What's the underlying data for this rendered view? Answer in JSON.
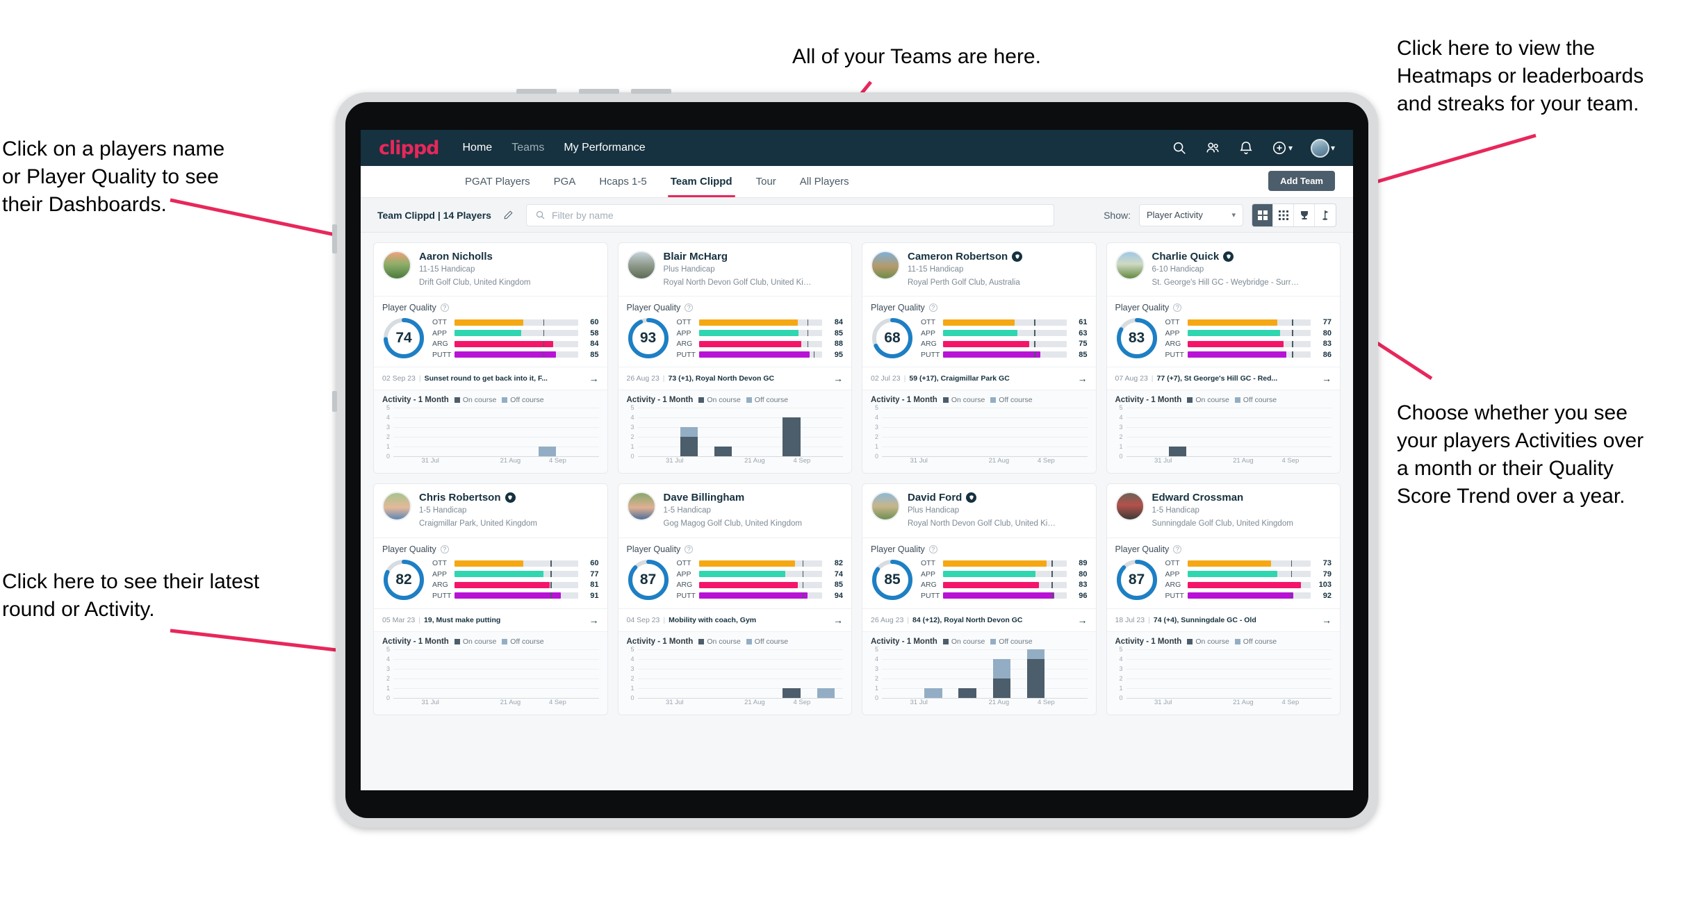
{
  "annotations": [
    {
      "id": "anno-teams",
      "text": "All of your Teams are here."
    },
    {
      "id": "anno-heatmaps",
      "text": "Click here to view the\nHeatmaps or leaderboards\nand streaks for your team."
    },
    {
      "id": "anno-names",
      "text": "Click on a players name\nor Player Quality to see\ntheir Dashboards."
    },
    {
      "id": "anno-activity",
      "text": "Choose whether you see\nyour players Activities over\na month or their Quality\nScore Trend over a year."
    },
    {
      "id": "anno-latest",
      "text": "Click here to see their latest\nround or Activity."
    }
  ],
  "header": {
    "logo": "clippd",
    "nav": [
      {
        "label": "Home",
        "active": true
      },
      {
        "label": "Teams",
        "active": false
      },
      {
        "label": "My Performance",
        "active": true
      }
    ],
    "icons": [
      "search-icon",
      "people-icon",
      "bell-icon",
      "plus-circle-icon"
    ],
    "avatar": "user-avatar"
  },
  "tabs": [
    {
      "label": "PGAT Players",
      "active": false
    },
    {
      "label": "PGA",
      "active": false
    },
    {
      "label": "Hcaps 1-5",
      "active": false
    },
    {
      "label": "Team Clippd",
      "active": true
    },
    {
      "label": "Tour",
      "active": false
    },
    {
      "label": "All Players",
      "active": false
    }
  ],
  "add_team_label": "Add Team",
  "filter_bar": {
    "team_label": "Team Clippd | 14 Players",
    "edit_icon": "pencil-icon",
    "search_placeholder": "Filter by name",
    "search_value": "",
    "show_label": "Show:",
    "show_value": "Player Activity",
    "view_modes": [
      {
        "icon": "grid-large-icon",
        "active": true
      },
      {
        "icon": "grid-dense-icon",
        "active": false
      },
      {
        "icon": "trophy-icon",
        "active": false
      },
      {
        "icon": "flag-pin-icon",
        "active": false
      }
    ]
  },
  "card_labels": {
    "player_quality": "Player Quality",
    "activity_title": "Activity - 1 Month",
    "legend_on": "On course",
    "legend_off": "Off course",
    "y_ticks": [
      "5",
      "4",
      "3",
      "2",
      "1",
      "0"
    ],
    "x_ticks": [
      "31 Jul",
      "21 Aug",
      "4 Sep"
    ]
  },
  "colors": {
    "ott": "#f5a814",
    "app": "#2fd6b0",
    "arg": "#f4156b",
    "putt": "#b712d6",
    "donut": "#1d7fc4",
    "donut_track": "#d7dce1",
    "on_course": "#4c5d6b",
    "off_course": "#93aec4",
    "accent_pink": "#e8275a",
    "header_bg": "#16313f"
  },
  "players": [
    {
      "name": "Aaron Nicholls",
      "verified": false,
      "handicap": "11-15 Handicap",
      "club": "Drift Golf Club, United Kingdom",
      "quality": 74,
      "metrics": [
        {
          "key": "OTT",
          "value": 60,
          "fill": 56,
          "tick": 72
        },
        {
          "key": "APP",
          "value": 58,
          "fill": 54,
          "tick": 72
        },
        {
          "key": "ARG",
          "value": 84,
          "fill": 80,
          "tick": 72
        },
        {
          "key": "PUTT",
          "value": 85,
          "fill": 82,
          "tick": 72
        }
      ],
      "round_date": "02 Sep 23",
      "round_text": "Sunset round to get back into it, F...",
      "activity": [
        {
          "on": 0,
          "off": 0
        },
        {
          "on": 0,
          "off": 0
        },
        {
          "on": 0,
          "off": 0
        },
        {
          "on": 0,
          "off": 0
        },
        {
          "on": 0,
          "off": 1
        },
        {
          "on": 0,
          "off": 0
        }
      ]
    },
    {
      "name": "Blair McHarg",
      "verified": false,
      "handicap": "Plus Handicap",
      "club": "Royal North Devon Golf Club, United Kin...",
      "quality": 93,
      "metrics": [
        {
          "key": "OTT",
          "value": 84,
          "fill": 80,
          "tick": 88
        },
        {
          "key": "APP",
          "value": 85,
          "fill": 81,
          "tick": 88
        },
        {
          "key": "ARG",
          "value": 88,
          "fill": 83,
          "tick": 88
        },
        {
          "key": "PUTT",
          "value": 95,
          "fill": 90,
          "tick": 93
        }
      ],
      "round_date": "26 Aug 23",
      "round_text": "73 (+1), Royal North Devon GC",
      "activity": [
        {
          "on": 0,
          "off": 0
        },
        {
          "on": 2,
          "off": 1
        },
        {
          "on": 1,
          "off": 0
        },
        {
          "on": 0,
          "off": 0
        },
        {
          "on": 4,
          "off": 0
        },
        {
          "on": 0,
          "off": 0
        }
      ]
    },
    {
      "name": "Cameron Robertson",
      "verified": true,
      "handicap": "11-15 Handicap",
      "club": "Royal Perth Golf Club, Australia",
      "quality": 68,
      "metrics": [
        {
          "key": "OTT",
          "value": 61,
          "fill": 58,
          "tick": 74
        },
        {
          "key": "APP",
          "value": 63,
          "fill": 60,
          "tick": 74
        },
        {
          "key": "ARG",
          "value": 75,
          "fill": 70,
          "tick": 74
        },
        {
          "key": "PUTT",
          "value": 85,
          "fill": 79,
          "tick": 74
        }
      ],
      "round_date": "02 Jul 23",
      "round_text": "59 (+17), Craigmillar Park GC",
      "activity": [
        {
          "on": 0,
          "off": 0
        },
        {
          "on": 0,
          "off": 0
        },
        {
          "on": 0,
          "off": 0
        },
        {
          "on": 0,
          "off": 0
        },
        {
          "on": 0,
          "off": 0
        },
        {
          "on": 0,
          "off": 0
        }
      ]
    },
    {
      "name": "Charlie Quick",
      "verified": true,
      "handicap": "6-10 Handicap",
      "club": "St. George's Hill GC - Weybridge - Surrey, ...",
      "quality": 83,
      "metrics": [
        {
          "key": "OTT",
          "value": 77,
          "fill": 73,
          "tick": 85
        },
        {
          "key": "APP",
          "value": 80,
          "fill": 75,
          "tick": 85
        },
        {
          "key": "ARG",
          "value": 83,
          "fill": 78,
          "tick": 85
        },
        {
          "key": "PUTT",
          "value": 86,
          "fill": 80,
          "tick": 85
        }
      ],
      "round_date": "07 Aug 23",
      "round_text": "77 (+7), St George's Hill GC - Red...",
      "activity": [
        {
          "on": 0,
          "off": 0
        },
        {
          "on": 1,
          "off": 0
        },
        {
          "on": 0,
          "off": 0
        },
        {
          "on": 0,
          "off": 0
        },
        {
          "on": 0,
          "off": 0
        },
        {
          "on": 0,
          "off": 0
        }
      ]
    },
    {
      "name": "Chris Robertson",
      "verified": true,
      "handicap": "1-5 Handicap",
      "club": "Craigmillar Park, United Kingdom",
      "quality": 82,
      "metrics": [
        {
          "key": "OTT",
          "value": 60,
          "fill": 56,
          "tick": 78
        },
        {
          "key": "APP",
          "value": 77,
          "fill": 72,
          "tick": 78
        },
        {
          "key": "ARG",
          "value": 81,
          "fill": 77,
          "tick": 78
        },
        {
          "key": "PUTT",
          "value": 91,
          "fill": 86,
          "tick": 78
        }
      ],
      "round_date": "05 Mar 23",
      "round_text": "19, Must make putting",
      "activity": [
        {
          "on": 0,
          "off": 0
        },
        {
          "on": 0,
          "off": 0
        },
        {
          "on": 0,
          "off": 0
        },
        {
          "on": 0,
          "off": 0
        },
        {
          "on": 0,
          "off": 0
        },
        {
          "on": 0,
          "off": 0
        }
      ]
    },
    {
      "name": "Dave Billingham",
      "verified": false,
      "handicap": "1-5 Handicap",
      "club": "Gog Magog Golf Club, United Kingdom",
      "quality": 87,
      "metrics": [
        {
          "key": "OTT",
          "value": 82,
          "fill": 78,
          "tick": 84
        },
        {
          "key": "APP",
          "value": 74,
          "fill": 70,
          "tick": 84
        },
        {
          "key": "ARG",
          "value": 85,
          "fill": 80,
          "tick": 84
        },
        {
          "key": "PUTT",
          "value": 94,
          "fill": 88,
          "tick": 84
        }
      ],
      "round_date": "04 Sep 23",
      "round_text": "Mobility with coach, Gym",
      "activity": [
        {
          "on": 0,
          "off": 0
        },
        {
          "on": 0,
          "off": 0
        },
        {
          "on": 0,
          "off": 0
        },
        {
          "on": 0,
          "off": 0
        },
        {
          "on": 1,
          "off": 0
        },
        {
          "on": 0,
          "off": 1
        }
      ]
    },
    {
      "name": "David Ford",
      "verified": true,
      "handicap": "Plus Handicap",
      "club": "Royal North Devon Golf Club, United Kin...",
      "quality": 85,
      "metrics": [
        {
          "key": "OTT",
          "value": 89,
          "fill": 84,
          "tick": 88
        },
        {
          "key": "APP",
          "value": 80,
          "fill": 75,
          "tick": 88
        },
        {
          "key": "ARG",
          "value": 83,
          "fill": 78,
          "tick": 88
        },
        {
          "key": "PUTT",
          "value": 96,
          "fill": 90,
          "tick": 88
        }
      ],
      "round_date": "26 Aug 23",
      "round_text": "84 (+12), Royal North Devon GC",
      "activity": [
        {
          "on": 0,
          "off": 0
        },
        {
          "on": 0,
          "off": 1
        },
        {
          "on": 1,
          "off": 0
        },
        {
          "on": 2,
          "off": 2
        },
        {
          "on": 4,
          "off": 1
        },
        {
          "on": 0,
          "off": 0
        }
      ]
    },
    {
      "name": "Edward Crossman",
      "verified": false,
      "handicap": "1-5 Handicap",
      "club": "Sunningdale Golf Club, United Kingdom",
      "quality": 87,
      "metrics": [
        {
          "key": "OTT",
          "value": 73,
          "fill": 68,
          "tick": 84
        },
        {
          "key": "APP",
          "value": 79,
          "fill": 73,
          "tick": 84
        },
        {
          "key": "ARG",
          "value": 103,
          "fill": 92,
          "tick": 0
        },
        {
          "key": "PUTT",
          "value": 92,
          "fill": 86,
          "tick": 84
        }
      ],
      "round_date": "18 Jul 23",
      "round_text": "74 (+4), Sunningdale GC - Old",
      "activity": [
        {
          "on": 0,
          "off": 0
        },
        {
          "on": 0,
          "off": 0
        },
        {
          "on": 0,
          "off": 0
        },
        {
          "on": 0,
          "off": 0
        },
        {
          "on": 0,
          "off": 0
        },
        {
          "on": 0,
          "off": 0
        }
      ]
    }
  ]
}
